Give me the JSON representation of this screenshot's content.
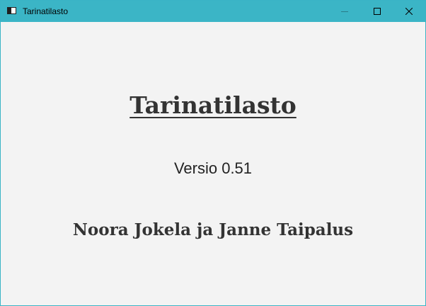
{
  "window": {
    "title": "Tarinatilasto",
    "accent_color": "#3bb5c6",
    "background_color": "#f3f3f3",
    "controls": {
      "minimize_icon": "minimize-icon",
      "maximize_icon": "maximize-icon",
      "close_icon": "close-icon"
    }
  },
  "main": {
    "title": "Tarinatilasto",
    "version": "Versio 0.51",
    "authors": "Noora Jokela ja Janne Taipalus"
  }
}
